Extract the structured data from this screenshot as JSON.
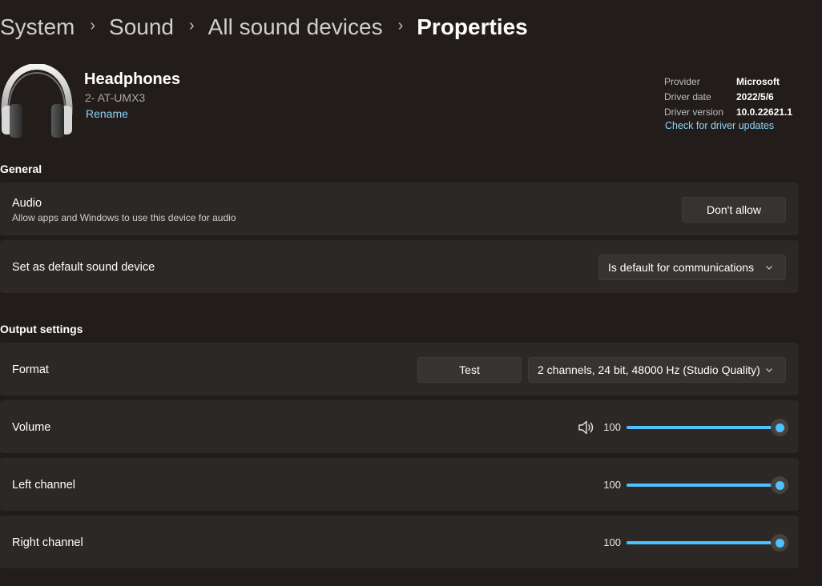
{
  "breadcrumb": {
    "items": [
      "System",
      "Sound",
      "All sound devices"
    ],
    "current": "Properties"
  },
  "device": {
    "icon": "headphones-icon",
    "name": "Headphones",
    "subtitle": "2- AT-UMX3",
    "rename_label": "Rename"
  },
  "driver": {
    "rows": [
      {
        "key": "Provider",
        "value": "Microsoft"
      },
      {
        "key": "Driver date",
        "value": "2022/5/6"
      },
      {
        "key": "Driver version",
        "value": "10.0.22621.1"
      }
    ],
    "update_link": "Check for driver updates"
  },
  "general": {
    "title": "General",
    "audio": {
      "label": "Audio",
      "description": "Allow apps and Windows to use this device for audio",
      "button": "Don't allow"
    },
    "default_device": {
      "label": "Set as default sound device",
      "selected": "Is default for communications"
    }
  },
  "output": {
    "title": "Output settings",
    "format": {
      "label": "Format",
      "test_button": "Test",
      "selected": "2 channels, 24 bit, 48000 Hz (Studio Quality)"
    },
    "volume": {
      "label": "Volume",
      "value": "100",
      "level": 1.0,
      "icon": "speaker-icon"
    },
    "left_channel": {
      "label": "Left channel",
      "value": "100",
      "level": 1.0
    },
    "right_channel": {
      "label": "Right channel",
      "value": "100",
      "level": 1.0
    }
  },
  "colors": {
    "background": "#221d1b",
    "card": "#2c2826",
    "accent": "#4cc2ff",
    "link": "#8ed4f5"
  }
}
